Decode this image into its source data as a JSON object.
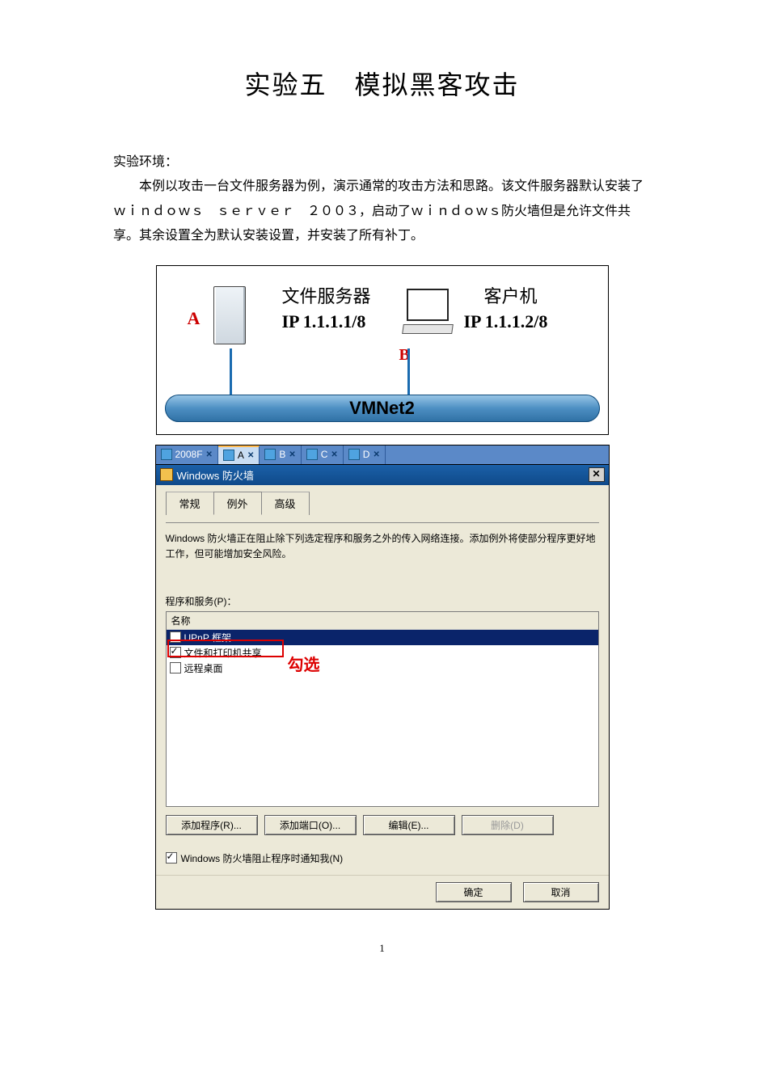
{
  "title": "实验五　模拟黑客攻击",
  "env_label": "实验环境：",
  "env_para": "本例以攻击一台文件服务器为例，演示通常的攻击方法和思路。该文件服务器默认安装了ｗｉｎｄｏｗｓ　ｓｅｒｖｅｒ　２００３，启动了ｗｉｎｄｏｗｓ防火墙但是允许文件共享。其余设置全为默认安装设置，并安装了所有补丁。",
  "diagram": {
    "vmnet": "VMNet2",
    "server_label": "文件服务器",
    "server_ip": "IP  1.1.1.1/8",
    "server_letter": "A",
    "client_label": "客户机",
    "client_ip": "IP  1.1.1.2/8",
    "client_letter": "B"
  },
  "tabstrip": {
    "items": [
      {
        "label": "2008F"
      },
      {
        "label": "A",
        "active": true
      },
      {
        "label": "B"
      },
      {
        "label": "C"
      },
      {
        "label": "D"
      }
    ]
  },
  "dialog": {
    "title": "Windows 防火墙",
    "tabs": [
      "常规",
      "例外",
      "高级"
    ],
    "active_tab": 1,
    "desc": "Windows 防火墙正在阻止除下列选定程序和服务之外的传入网络连接。添加例外将使部分程序更好地工作，但可能增加安全风险。",
    "group_label": "程序和服务(P)：",
    "list_header": "名称",
    "items": [
      {
        "label": "UPnP 框架",
        "checked": false,
        "selected": true
      },
      {
        "label": "文件和打印机共享",
        "checked": true,
        "selected": false
      },
      {
        "label": "远程桌面",
        "checked": false,
        "selected": false
      }
    ],
    "annotation": "勾选",
    "buttons": {
      "add_prog": "添加程序(R)...",
      "add_port": "添加端口(O)...",
      "edit": "编辑(E)...",
      "del": "删除(D)"
    },
    "notify_label": "Windows 防火墙阻止程序时通知我(N)",
    "notify_checked": true,
    "ok": "确定",
    "cancel": "取消"
  },
  "page_number": "1"
}
